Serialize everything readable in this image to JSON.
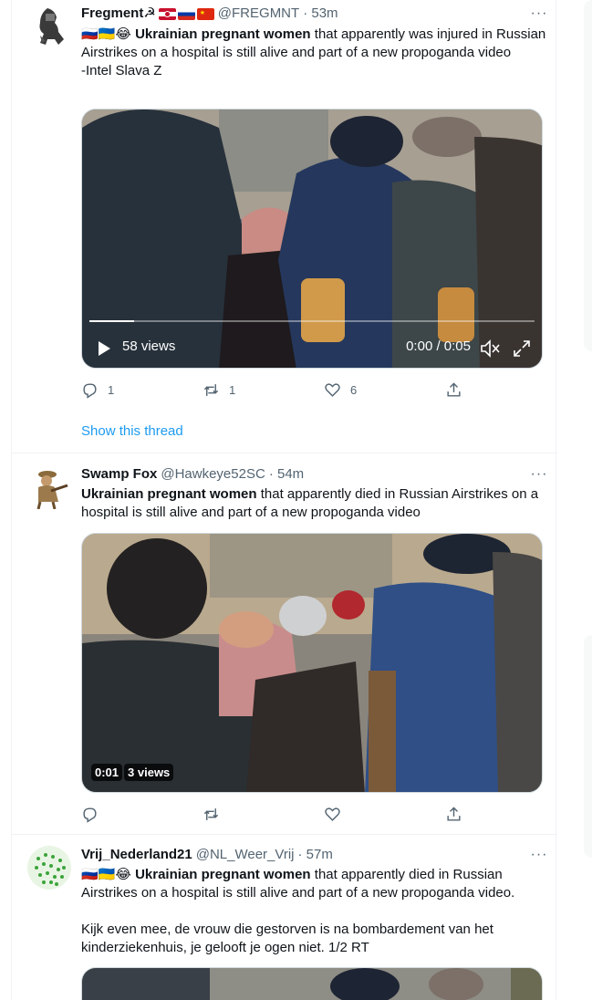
{
  "tweets": [
    {
      "name": "Fregment☭",
      "handle": "@FREGMNT",
      "time": "· 53m",
      "text_flags": "🇷🇺🇺🇦😂",
      "text_bold": "Ukrainian pregnant women",
      "text_rest": " that apparently was injured in Russian Airstrikes on a hospital is still alive and part of a new propoganda video",
      "text_line2": "-Intel Slava Z",
      "views": "58 views",
      "time_display": "0:00 / 0:05",
      "reply_count": "1",
      "retweet_count": "1",
      "like_count": "6",
      "show_thread": "Show this thread"
    },
    {
      "name": "Swamp Fox",
      "handle": "@Hawkeye52SC",
      "time": "· 54m",
      "text_bold": "Ukrainian pregnant women",
      "text_rest": " that apparently died in Russian Airstrikes on a hospital is still alive and part of a new propoganda video",
      "duration": "0:01",
      "views": "3 views"
    },
    {
      "name": "Vrij_Nederland21",
      "handle": "@NL_Weer_Vrij",
      "time": "· 57m",
      "text_flags": "🇷🇺🇺🇦😂",
      "text_bold": "Ukrainian pregnant women",
      "text_rest": " that apparently died in Russian Airstrikes on a hospital is still alive and part of a new propoganda video.",
      "text_para2": "Kijk even mee, de vrouw die gestorven is na bombardement van het kinderziekenhuis, je gelooft je ogen niet. 1/2 RT"
    }
  ],
  "more_label": "···",
  "colors": {
    "link": "#1d9bf0",
    "secondary": "#536471",
    "border": "#eff3f4"
  }
}
